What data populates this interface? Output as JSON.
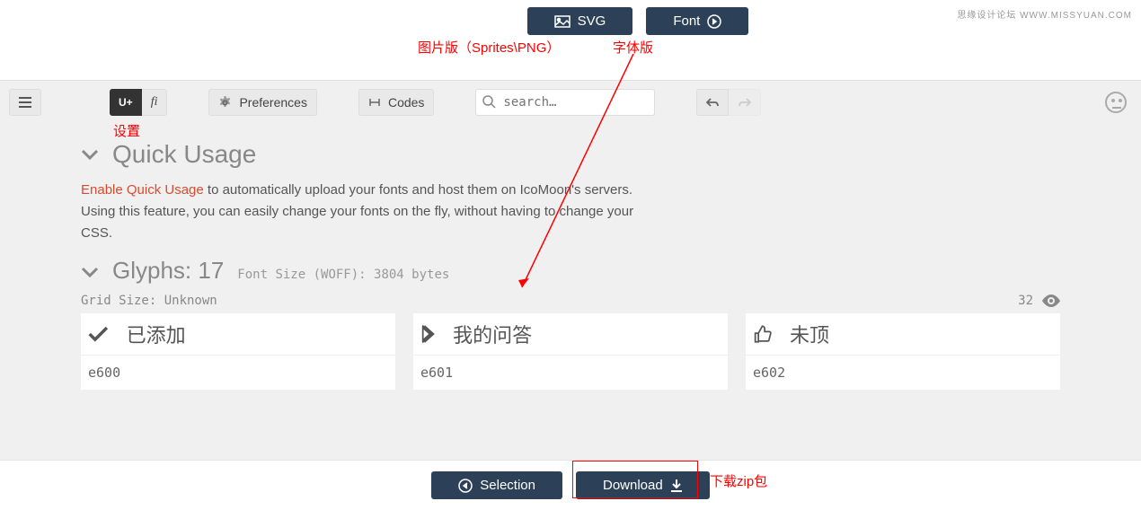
{
  "watermark": "思缘设计论坛  WWW.MISSYUAN.COM",
  "topButtons": {
    "svg": "SVG",
    "font": "Font"
  },
  "annotations": {
    "svg_sub": "图片版（Sprites\\PNG）",
    "font_sub": "字体版",
    "settings": "设置",
    "download_zip": "下载zip包"
  },
  "toolbar": {
    "unicode": "U+",
    "ligature": "fi",
    "preferences": "Preferences",
    "codes": "Codes",
    "search_placeholder": "search…"
  },
  "sections": {
    "quick_usage_title": "Quick Usage",
    "quick_usage_link": "Enable Quick Usage",
    "quick_usage_desc": " to automatically upload your fonts and host them on IcoMoon's servers. Using this feature, you can easily change your fonts on the fly, without having to change your CSS.",
    "glyphs_title": "Glyphs: 17",
    "glyphs_sub": "Font Size (WOFF): 3804 bytes",
    "grid_size": "Grid Size: Unknown",
    "grid_count": "32"
  },
  "glyphs": [
    {
      "name": "已添加",
      "code": "e600",
      "icon": "check"
    },
    {
      "name": "我的问答",
      "code": "e601",
      "icon": "chevron-right"
    },
    {
      "name": "未顶",
      "code": "e602",
      "icon": "thumbs-up"
    }
  ],
  "footer": {
    "selection": "Selection",
    "download": "Download"
  }
}
